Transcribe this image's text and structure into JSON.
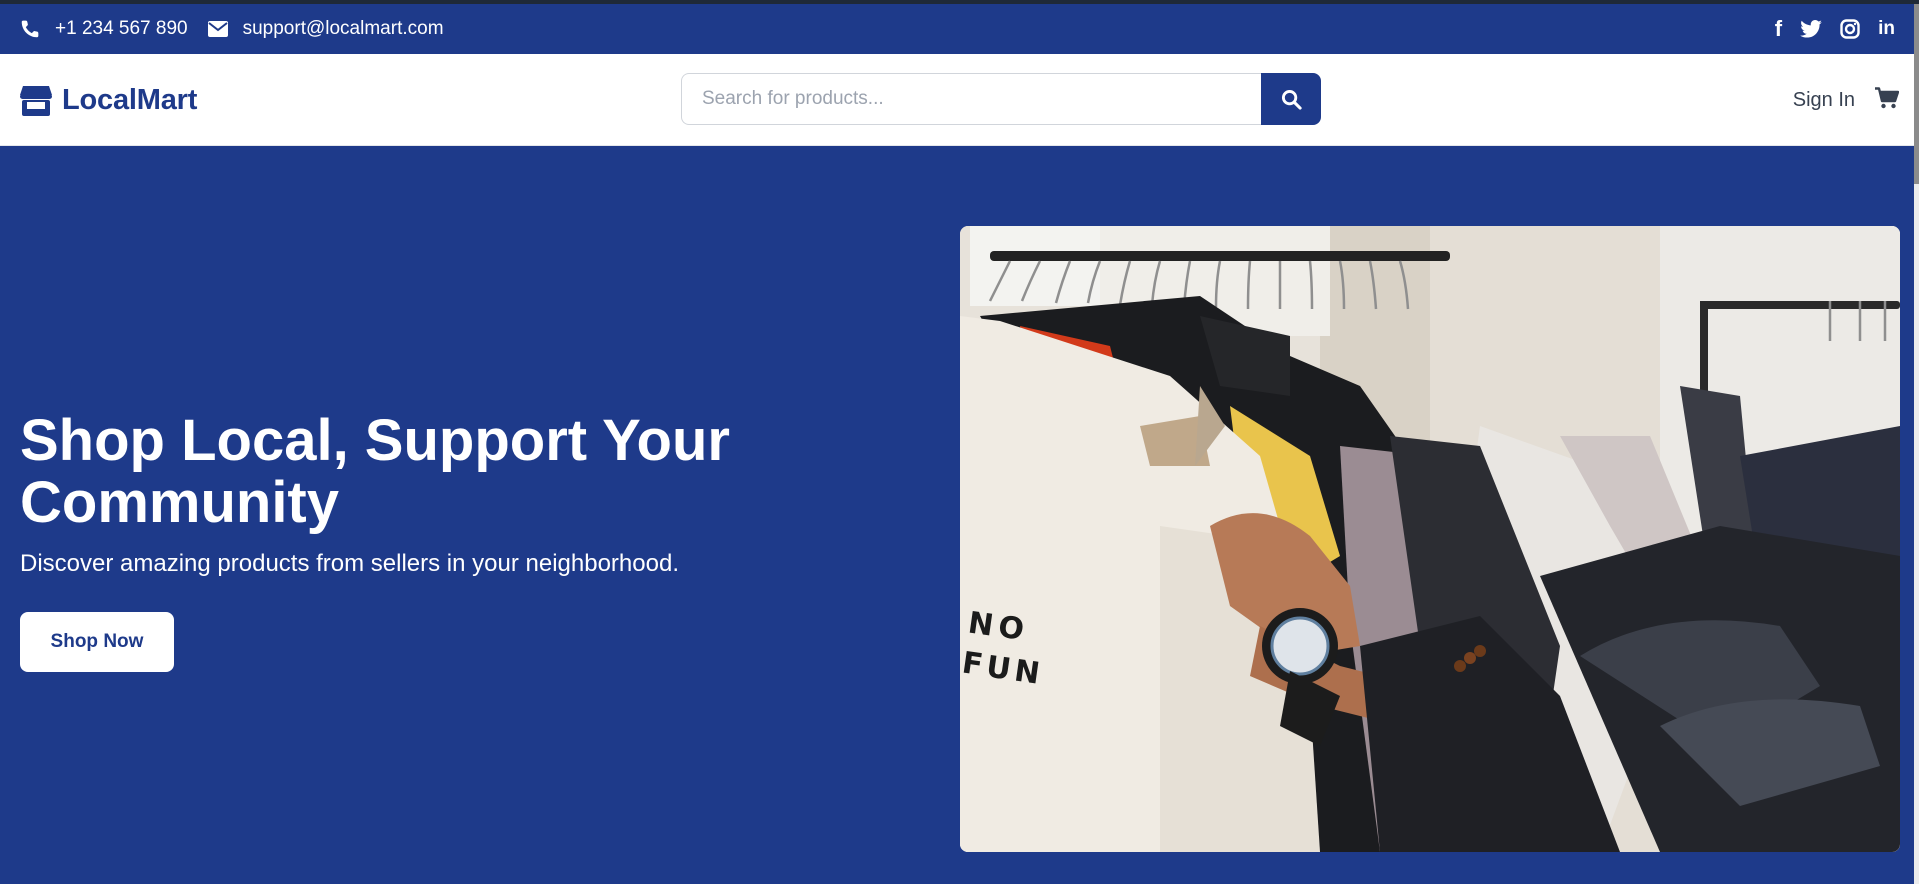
{
  "topbar": {
    "phone": "+1 234 567 890",
    "email": "support@localmart.com",
    "socials": [
      {
        "name": "facebook-icon",
        "glyph": "f"
      },
      {
        "name": "twitter-icon",
        "glyph": ""
      },
      {
        "name": "instagram-icon",
        "glyph": ""
      },
      {
        "name": "linkedin-icon",
        "glyph": "in"
      }
    ]
  },
  "navbar": {
    "brand": "LocalMart",
    "search_placeholder": "Search for products...",
    "signin": "Sign In"
  },
  "hero": {
    "title": "Shop Local, Support Your Community",
    "subtitle": "Discover amazing products from sellers in your neighborhood.",
    "cta": "Shop Now",
    "image_print": "NO FUN"
  },
  "colors": {
    "primary": "#1e3a8a",
    "white": "#ffffff",
    "text_dark": "#374151"
  }
}
